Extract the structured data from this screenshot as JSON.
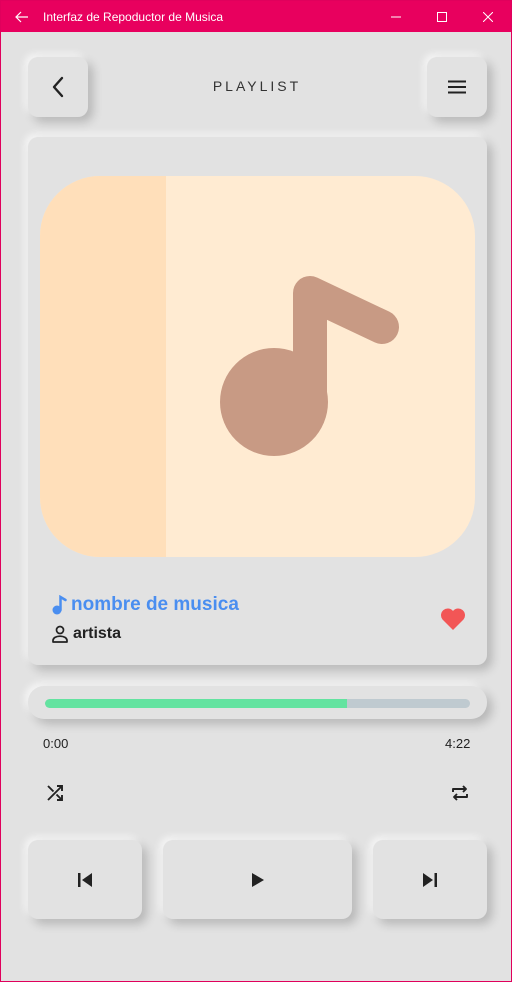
{
  "window": {
    "title": "Interfaz de Repoductor de Musica"
  },
  "header": {
    "title": "PLAYLIST"
  },
  "song": {
    "title": "nombre de musica",
    "artist": "artista",
    "favorite": true
  },
  "progress": {
    "current": "0:00",
    "total": "4:22",
    "fraction": 0.71
  },
  "icons": {
    "back": "chevron-left-icon",
    "menu": "hamburger-menu-icon",
    "note": "music-note-icon",
    "person": "person-icon",
    "heart": "heart-icon",
    "shuffle": "shuffle-icon",
    "repeat": "repeat-icon",
    "previous": "skip-previous-icon",
    "play": "play-icon",
    "next": "skip-next-icon"
  },
  "colors": {
    "titlebar": "#e8005e",
    "background": "#e2e2e2",
    "song_title": "#4a8ef0",
    "heart": "#f25656",
    "progress_fill": "#63e3a0",
    "progress_track": "#bfcad0",
    "art_background": "#ffebd2",
    "art_note": "#c89a84"
  }
}
